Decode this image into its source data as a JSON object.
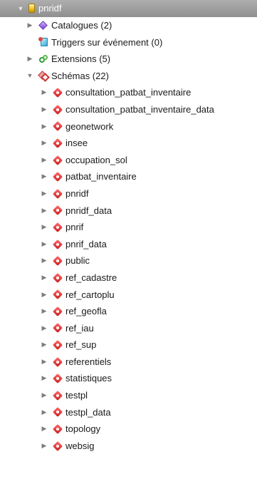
{
  "tree": {
    "root": {
      "label": "pnridf",
      "icon": "database-icon"
    },
    "groups": {
      "catalogues": {
        "label": "Catalogues (2)",
        "icon": "catalogue-icon"
      },
      "triggers": {
        "label": "Triggers sur événement (0)",
        "icon": "trigger-icon"
      },
      "extensions": {
        "label": "Extensions (5)",
        "icon": "extension-icon"
      },
      "schemas": {
        "label": "Schémas (22)",
        "icon": "schemas-icon"
      }
    },
    "schemas": [
      {
        "label": "consultation_patbat_inventaire"
      },
      {
        "label": "consultation_patbat_inventaire_data"
      },
      {
        "label": "geonetwork"
      },
      {
        "label": "insee"
      },
      {
        "label": "occupation_sol"
      },
      {
        "label": "patbat_inventaire"
      },
      {
        "label": "pnridf"
      },
      {
        "label": "pnridf_data"
      },
      {
        "label": "pnrif"
      },
      {
        "label": "pnrif_data"
      },
      {
        "label": "public"
      },
      {
        "label": "ref_cadastre"
      },
      {
        "label": "ref_cartoplu"
      },
      {
        "label": "ref_geofla"
      },
      {
        "label": "ref_iau"
      },
      {
        "label": "ref_sup"
      },
      {
        "label": "referentiels"
      },
      {
        "label": "statistiques"
      },
      {
        "label": "testpl"
      },
      {
        "label": "testpl_data"
      },
      {
        "label": "topology"
      },
      {
        "label": "websig"
      }
    ],
    "arrows": {
      "expanded": "▼",
      "collapsed": "▶"
    },
    "colors": {
      "selection": "#9b9b9b",
      "schema_icon": "#d32b2b",
      "catalogue_icon": "#7b3fd9"
    }
  }
}
